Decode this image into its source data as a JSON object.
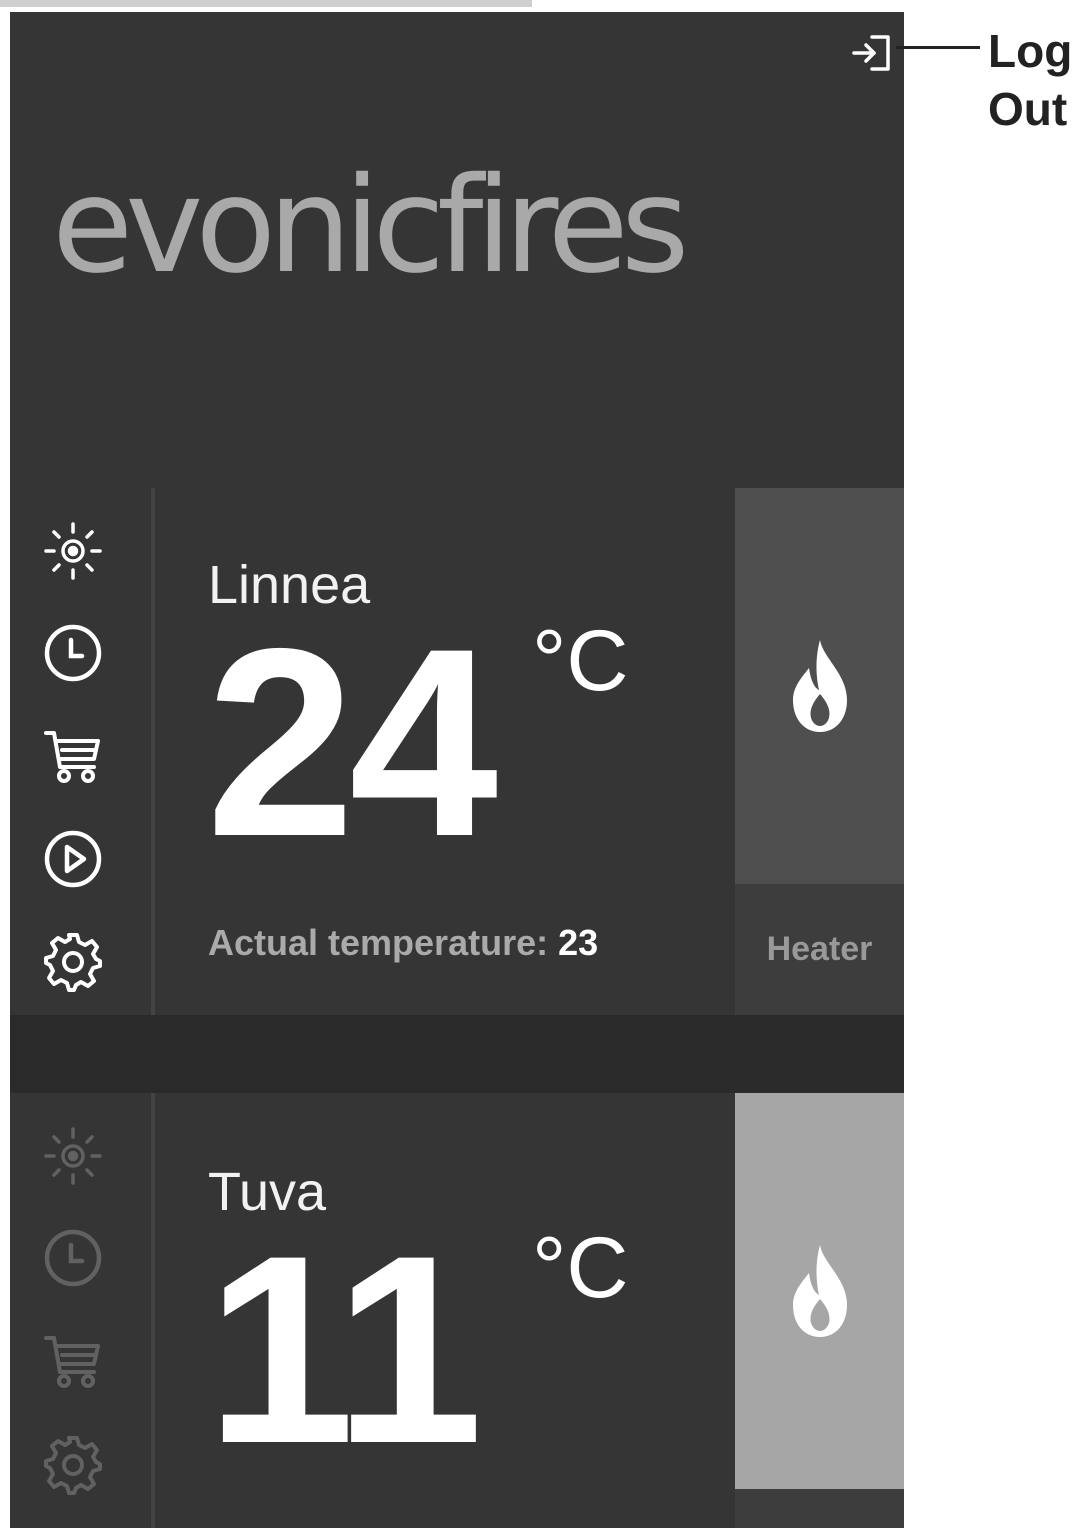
{
  "app": {
    "logo_text": "evonicfires"
  },
  "callout": {
    "line1": "Log",
    "line2": "Out"
  },
  "fires": [
    {
      "name": "Linnea",
      "temperature": "24",
      "unit": "°C",
      "actual_label": "Actual temperature:",
      "actual_value": "23",
      "mode_label": "Heater",
      "heater_state": "off"
    },
    {
      "name": "Tuva",
      "temperature": "11",
      "unit": "°C",
      "heater_state": "on"
    }
  ],
  "icons": [
    "sun-icon",
    "clock-icon",
    "cart-icon",
    "play-icon",
    "gear-icon",
    "logout-icon",
    "flame-icon"
  ],
  "colors": {
    "background": "#353535",
    "divider": "#444444",
    "heater_off": "#4f4f4f",
    "heater_on": "#a6a6a6",
    "logo": "#a9a9a9"
  }
}
